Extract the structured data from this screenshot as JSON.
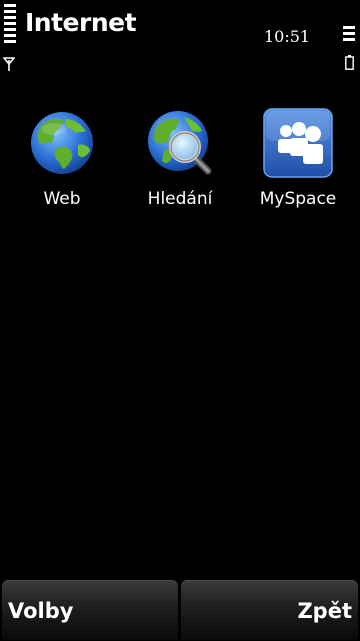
{
  "header": {
    "title": "Internet",
    "clock": "10:51",
    "signal_icon": "signal-strength-icon",
    "battery_icon": "battery-icon"
  },
  "apps": [
    {
      "label": "Web",
      "icon": "globe-icon"
    },
    {
      "label": "Hledání",
      "icon": "globe-search-icon"
    },
    {
      "label": "MySpace",
      "icon": "myspace-icon"
    }
  ],
  "softkeys": {
    "left": "Volby",
    "right": "Zpět"
  },
  "colors": {
    "background": "#000000",
    "text": "#ffffff",
    "myspace_blue": "#2f67c4",
    "globe_ocean": "#2a6fd4",
    "globe_land": "#5fae2e"
  }
}
